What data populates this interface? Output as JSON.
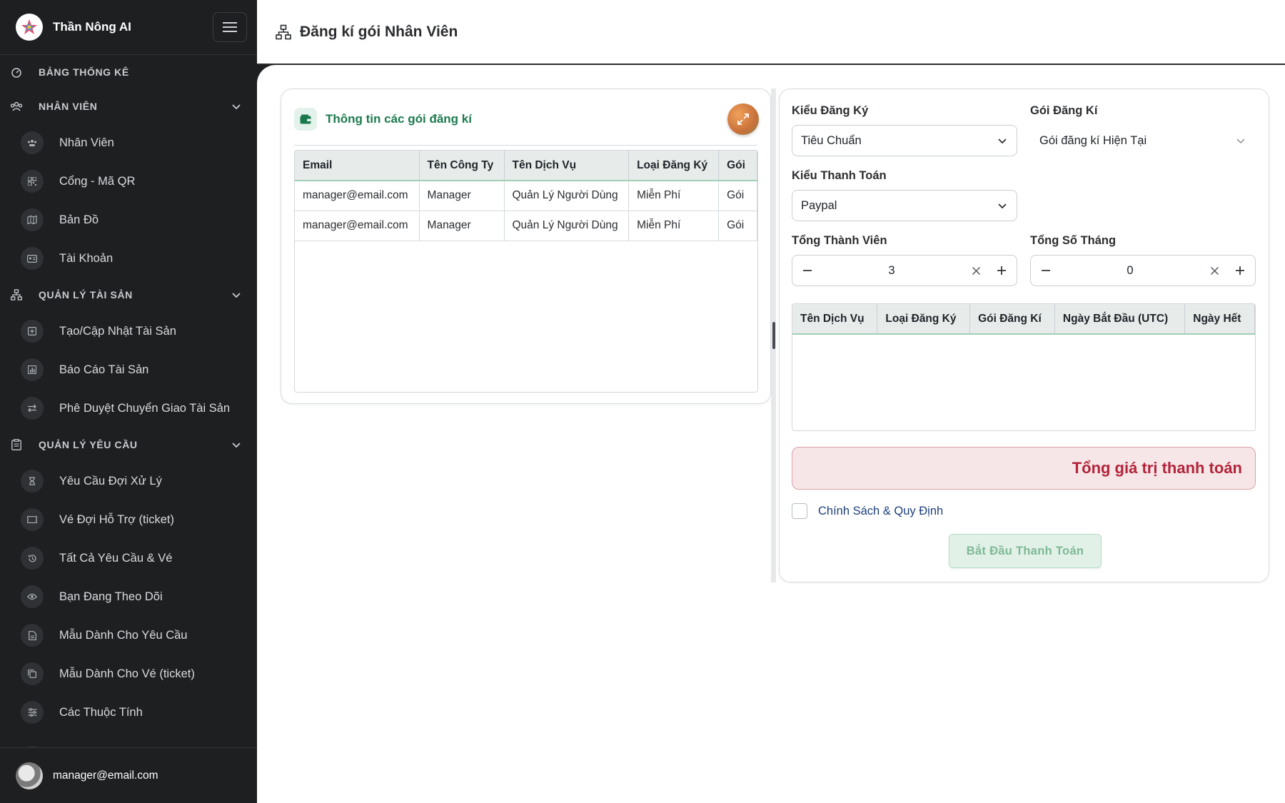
{
  "app": {
    "name": "Thần Nông AI",
    "user_email": "manager@email.com"
  },
  "sidebar": {
    "sections": [
      {
        "label": "BẢNG THỐNG KÊ",
        "icon": "dashboard-icon",
        "items": []
      },
      {
        "label": "NHÂN VIÊN",
        "icon": "team-icon",
        "items": [
          {
            "label": "Nhân Viên",
            "icon": "users-icon"
          },
          {
            "label": "Cổng - Mã QR",
            "icon": "qr-icon"
          },
          {
            "label": "Bản Đồ",
            "icon": "map-icon"
          },
          {
            "label": "Tài Khoản",
            "icon": "id-card-icon"
          }
        ]
      },
      {
        "label": "QUẢN LÝ TÀI SẢN",
        "icon": "hierarchy-icon",
        "items": [
          {
            "label": "Tạo/Cập Nhật Tài Sản",
            "icon": "plus-square-icon"
          },
          {
            "label": "Báo Cáo Tài Sản",
            "icon": "bar-chart-icon"
          },
          {
            "label": "Phê Duyệt Chuyển Giao Tài Sản",
            "icon": "transfer-icon"
          }
        ]
      },
      {
        "label": "QUẢN LÝ YÊU CẦU",
        "icon": "clipboard-icon",
        "items": [
          {
            "label": "Yêu Cầu Đợi Xử Lý",
            "icon": "hourglass-icon"
          },
          {
            "label": "Vé Đợi Hỗ Trợ (ticket)",
            "icon": "ticket-icon"
          },
          {
            "label": "Tất Cả Yêu Cầu & Vé",
            "icon": "history-icon"
          },
          {
            "label": "Bạn Đang Theo Dõi",
            "icon": "eye-icon"
          },
          {
            "label": "Mẫu Dành Cho Yêu Cầu",
            "icon": "document-icon"
          },
          {
            "label": "Mẫu Dành Cho Vé (ticket)",
            "icon": "copy-icon"
          },
          {
            "label": "Các Thuộc Tính",
            "icon": "sliders-icon"
          }
        ]
      }
    ]
  },
  "header": {
    "title": "Đăng kí gói Nhân Viên"
  },
  "subscriptions_card": {
    "title": "Thông tin các gói đăng kí",
    "columns": [
      "Email",
      "Tên Công Ty",
      "Tên Dịch Vụ",
      "Loại Đăng Ký",
      "Gói"
    ],
    "rows": [
      [
        "manager@email.com",
        "Manager",
        "Quản Lý Người Dùng",
        "Miễn Phí",
        "Gói"
      ],
      [
        "manager@email.com",
        "Manager",
        "Quản Lý Người Dùng",
        "Miễn Phí",
        "Gói"
      ]
    ]
  },
  "form": {
    "reg_type_label": "Kiểu Đăng Ký",
    "reg_type_value": "Tiêu Chuẩn",
    "package_label": "Gói Đăng Kí",
    "package_value": "Gói đăng kí Hiện Tại",
    "payment_type_label": "Kiểu Thanh Toán",
    "payment_type_value": "Paypal",
    "members_label": "Tổng Thành Viên",
    "members_value": "3",
    "months_label": "Tổng Số Tháng",
    "months_value": "0",
    "services_columns": [
      "Tên Dịch Vụ",
      "Loại Đăng Ký",
      "Gói Đăng Kí",
      "Ngày Bắt Đầu (UTC)",
      "Ngày Hết"
    ],
    "total_label": "Tổng giá trị thanh toán",
    "policy_label": "Chính Sách & Quy Định",
    "pay_button": "Bắt Đầu Thanh Toán"
  },
  "colors": {
    "sidebar_bg": "#1e1f21",
    "accent_green": "#1b7a4d",
    "total_red": "#b3243a",
    "policy_blue": "#1c3f7a"
  }
}
